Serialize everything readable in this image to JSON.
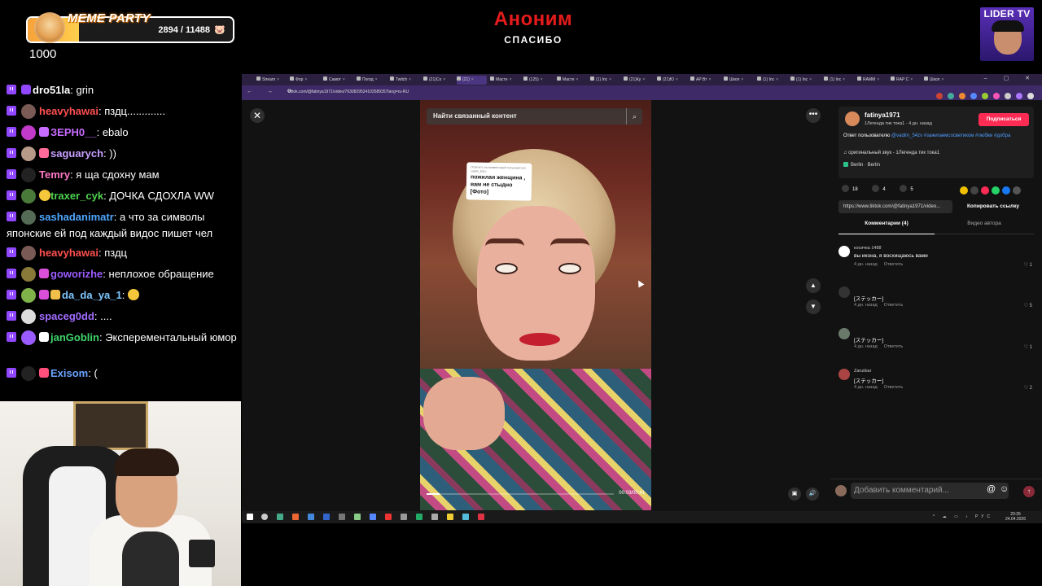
{
  "meme_party": {
    "title": "MEME PARTY",
    "current": "2894",
    "max": "11488",
    "count_text": "2894 / 11488",
    "progress": 0.25,
    "total": "1000"
  },
  "alert": {
    "name": "Аноним",
    "subtitle": "СПАСИБО"
  },
  "logo": {
    "text": "LIDER TV"
  },
  "chat": {
    "messages": [
      {
        "user": "dro51la",
        "text": "grin",
        "color": "#ffffff"
      },
      {
        "user": "heavyhawai",
        "text": "пздц.............",
        "color": "#ff4f4f"
      },
      {
        "user": "ЗЕРН0__",
        "text": "ebalo",
        "color": "#c86cff"
      },
      {
        "user": "saguarych",
        "text": "))",
        "color": "#c8a0ff"
      },
      {
        "user": "Temry",
        "text": "я ща сдохну мам",
        "color": "#ff78c8"
      },
      {
        "user": "traxer_cyk",
        "text": "ДОЧКА СДОХЛА WW",
        "color": "#4fd14f"
      },
      {
        "user": "sashadanimatr",
        "text": "а что за символы японские ей под каждый видос пишет чел",
        "color": "#4fa7ff"
      },
      {
        "user": "heavyhawai",
        "text": "пздц",
        "color": "#ff4f4f"
      },
      {
        "user": "goworizhe",
        "text": "неплохое обращение",
        "color": "#9b5cff"
      },
      {
        "user": "da_da_ya_1",
        "text": "",
        "color": "#7ec8ff"
      },
      {
        "user": "spaceg0dd",
        "text": "....",
        "color": "#a06cff"
      },
      {
        "user": "janGoblin",
        "text": "Эксперементальный юмор",
        "color": "#3fd66b"
      },
      {
        "user": "Exisom",
        "text": "(",
        "color": "#6aa3ff"
      }
    ]
  },
  "browser": {
    "tabs": [
      "Stream",
      "Фор",
      "Самот",
      "Погод",
      "Twitch",
      "(21)Со",
      "(21)",
      "Масте",
      "(125)",
      "Масте",
      "(1) Inc",
      "(21)Ку",
      "(21)Ю",
      "AP Вт",
      "Школ",
      "(1) Inc",
      "(1) Inc",
      "(1) Inc",
      "RAMM",
      "RAP C",
      "Школ"
    ],
    "url": "tiktok.com/@fatinya1971/video/7630829524103589357lang=ru-RU"
  },
  "video": {
    "search_placeholder": "Найти связанный контент",
    "sticker_header": "Ответить на комментарий пользователя vadim_54zv",
    "sticker_text": "пожилая женщина , вам не стыдно [Фото]",
    "timecode": "00:03/00:41",
    "progress": 0.07
  },
  "post": {
    "author": "fatinya1971",
    "author_sub": "1Легенда тик тока1 · 4 дн. назад",
    "subscribe": "Подписаться",
    "desc_prefix": "Ответ пользователю",
    "desc_tags": "@vadim_54zv #зажигаемсосветиком #любви #добра",
    "sound": "♫  оригинальный звук - 1Легенда тик тока1",
    "location": "Berlin · Berlin",
    "likes": "18",
    "comments_count": "4",
    "saves": "5",
    "link": "https://www.tiktok.com/@fatinya1971/video...",
    "copy_link": "Копировать ссылку",
    "tab_comments": "Комментарии (4)",
    "tab_author_videos": "Видео автора"
  },
  "comments": [
    {
      "user": "косичка 1488",
      "text": "вы икона, я восхищаюсь вами",
      "time": "4 дн. назад",
      "reply": "Ответить",
      "likes": "1"
    },
    {
      "user": "",
      "text": "[ステッカー]",
      "time": "4 дн. назад",
      "reply": "Ответить",
      "likes": "5"
    },
    {
      "user": "",
      "text": "[ステッカー]",
      "time": "4 дн. назад",
      "reply": "Ответить",
      "likes": "1"
    },
    {
      "user": "Zanzibar",
      "text": "[ステッカー]",
      "time": "4 дн. назад",
      "reply": "Ответить",
      "likes": "2"
    }
  ],
  "comment_input": {
    "placeholder": "Добавить комментарий..."
  },
  "taskbar": {
    "time": "20:35",
    "date": "24.04.2026",
    "lang": "РУС"
  }
}
